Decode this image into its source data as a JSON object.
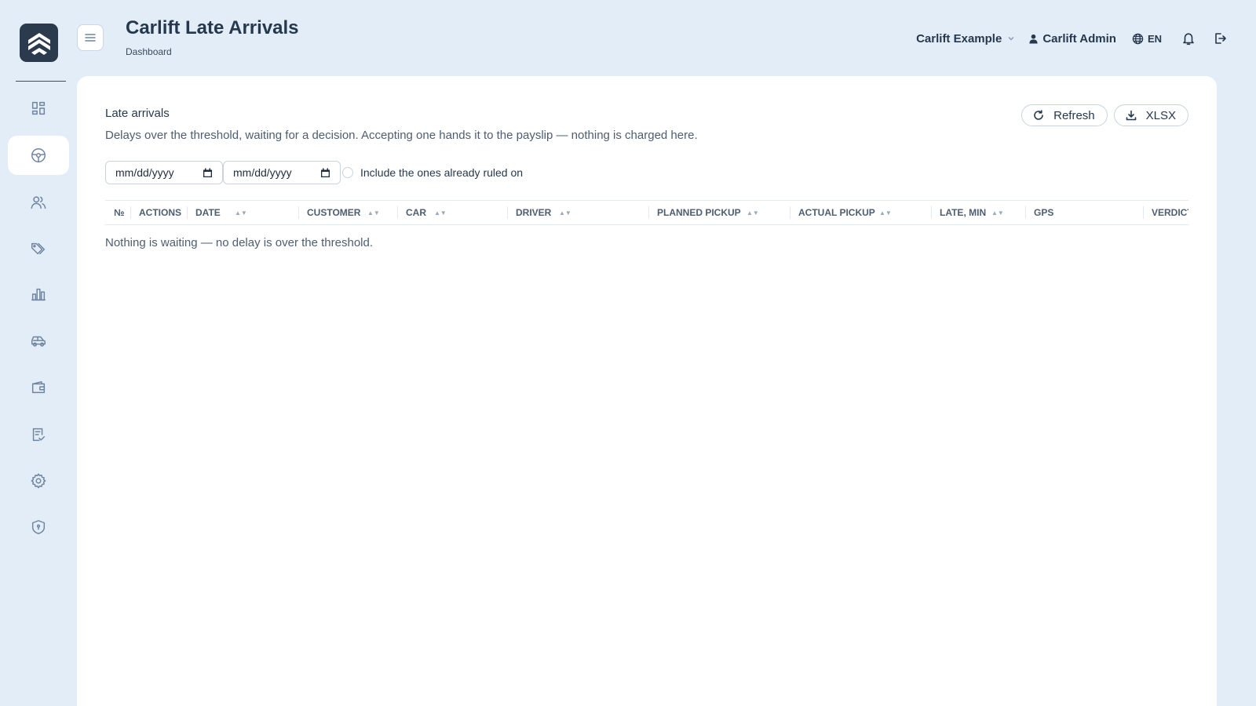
{
  "header": {
    "title": "Carlift Late Arrivals",
    "breadcrumb": "Dashboard",
    "company": "Carlift Example",
    "user": "Carlift Admin",
    "language": "EN"
  },
  "sidebar": {
    "items": [
      {
        "icon": "dashboard-icon"
      },
      {
        "icon": "steering-wheel-icon",
        "active": true
      },
      {
        "icon": "users-icon"
      },
      {
        "icon": "tags-icon"
      },
      {
        "icon": "bar-chart-icon"
      },
      {
        "icon": "car-icon"
      },
      {
        "icon": "wallet-icon"
      },
      {
        "icon": "checklist-icon"
      },
      {
        "icon": "gear-icon"
      },
      {
        "icon": "shield-icon"
      }
    ]
  },
  "main": {
    "section_title": "Late arrivals",
    "description": "Delays over the threshold, waiting for a decision. Accepting one hands it to the payslip — nothing is charged here.",
    "refresh_label": "Refresh",
    "export_label": "XLSX",
    "date_from_placeholder": "mm/dd/yyyy",
    "date_to_placeholder": "mm/dd/yyyy",
    "include_ruled_label": "Include the ones already ruled on",
    "columns": [
      "№",
      "ACTIONS",
      "DATE",
      "CUSTOMER",
      "CAR",
      "DRIVER",
      "PLANNED PICKUP",
      "ACTUAL PICKUP",
      "LATE, MIN",
      "GPS",
      "VERDICT"
    ],
    "empty_message": "Nothing is waiting — no delay is over the threshold."
  },
  "colors": {
    "background": "#e3edf7",
    "sidebar_icon": "#6f84a0",
    "logo_bg": "#2b3a4c",
    "text_dark": "#26384d"
  }
}
